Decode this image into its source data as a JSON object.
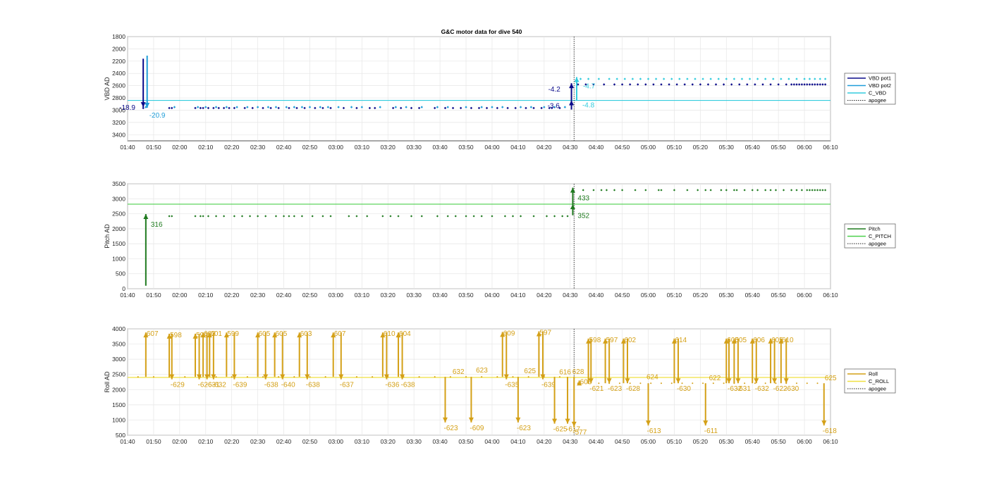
{
  "figure_title": "G&C motor data for dive 540",
  "x_ticks": [
    "01:40",
    "01:50",
    "02:00",
    "02:10",
    "02:20",
    "02:30",
    "02:40",
    "02:50",
    "03:00",
    "03:10",
    "03:20",
    "03:30",
    "03:40",
    "03:50",
    "04:00",
    "04:10",
    "04:20",
    "04:30",
    "04:40",
    "04:50",
    "05:00",
    "05:10",
    "05:20",
    "05:30",
    "05:40",
    "05:50",
    "06:00",
    "06:10"
  ],
  "chart_data": [
    {
      "type": "scatter",
      "title": "G&C motor data for dive 540",
      "ylabel": "VBD AD",
      "xlim_minutes": [
        100,
        370
      ],
      "ylim": [
        1800,
        3500
      ],
      "y_reversed": true,
      "y_ticks": [
        1800,
        2000,
        2200,
        2400,
        2600,
        2800,
        3000,
        3200,
        3400
      ],
      "grid": true,
      "legend": [
        {
          "label": "VBD pot1",
          "color": "#0b0b8a",
          "style": "solid"
        },
        {
          "label": "VBD pot2",
          "color": "#1f9ed9",
          "style": "solid"
        },
        {
          "label": "C_VBD",
          "color": "#33ccdd",
          "style": "solid"
        },
        {
          "label": "apogee",
          "color": "#222222",
          "style": "dotted"
        }
      ],
      "legend_placement": "outside-right",
      "apogee_minutes": 271.5,
      "reference_line": {
        "name": "C_VBD",
        "value": 2840,
        "color": "#33ccdd"
      },
      "points_series1_before_apogee": {
        "y": 2965,
        "x_minutes": [
          106,
          116,
          117,
          126,
          128,
          129,
          131,
          133,
          135,
          137,
          139,
          141,
          145,
          148,
          152,
          155,
          158,
          162,
          165,
          168,
          172,
          175,
          178,
          183,
          188,
          193,
          195,
          202,
          205,
          209,
          212,
          218,
          222,
          225,
          228,
          232,
          235,
          238,
          242,
          246,
          249,
          253,
          256,
          259,
          262,
          263,
          266
        ]
      },
      "points_series2_before_apogee": {
        "y": 2950,
        "x_minutes": [
          107,
          118,
          127,
          130,
          134,
          138,
          142,
          146,
          150,
          154,
          157,
          161,
          164,
          167,
          170,
          174,
          177,
          181,
          186,
          190,
          197,
          203,
          207,
          213,
          219,
          223,
          230,
          236,
          240,
          244,
          251,
          255,
          260,
          264,
          268
        ]
      },
      "points_series1_after_apogee": {
        "y": 2580,
        "x_minutes": [
          273,
          276,
          279,
          283,
          287,
          290,
          293,
          296,
          299,
          302,
          305,
          308,
          311,
          314,
          317,
          320,
          323,
          326,
          329,
          332,
          335,
          338,
          341,
          344,
          347,
          350,
          353,
          355,
          356,
          357,
          358,
          359,
          360,
          361,
          362,
          363,
          364,
          365,
          366,
          367,
          368
        ]
      },
      "points_series2_after_apogee": {
        "y": 2490,
        "x_minutes": [
          274,
          277,
          281,
          285,
          288,
          291,
          294,
          297,
          300,
          303,
          306,
          309,
          312,
          315,
          318,
          321,
          324,
          327,
          330,
          333,
          336,
          339,
          342,
          345,
          348,
          351,
          354,
          357,
          360,
          362,
          364,
          366,
          368
        ]
      },
      "markers": [
        {
          "x_minutes": 106,
          "from": 2160,
          "to": 2950,
          "color": "#0b0b8a",
          "label": "-18.9",
          "label_color": "#0b0b8a"
        },
        {
          "x_minutes": 107.5,
          "from": 2110,
          "to": 2960,
          "color": "#1f9ed9",
          "label": "-20.9",
          "label_color": "#1f9ed9"
        },
        {
          "x_minutes": 270.5,
          "from": 2990,
          "to": 2840,
          "color": "#0b0b8a",
          "label": "-3.6",
          "label_color": "#0b0b8a"
        },
        {
          "x_minutes": 270.5,
          "from": 2840,
          "to": 2560,
          "color": "#0b0b8a",
          "label": "-4.2",
          "label_color": "#0b0b8a"
        },
        {
          "x_minutes": 272.5,
          "from": 2840,
          "to": 2460,
          "color": "#33ccdd",
          "label": "-4.7",
          "label_color": "#33ccdd"
        },
        {
          "x_minutes": 272.5,
          "from": 2840,
          "to": 2840,
          "color": "#33ccdd",
          "label": "-4.8",
          "label_color": "#33ccdd"
        }
      ]
    },
    {
      "type": "scatter",
      "ylabel": "Pitch AD",
      "xlim_minutes": [
        100,
        370
      ],
      "ylim": [
        0,
        3500
      ],
      "y_reversed": false,
      "y_ticks": [
        0,
        500,
        1000,
        1500,
        2000,
        2500,
        3000,
        3500
      ],
      "grid": true,
      "legend": [
        {
          "label": "Pitch",
          "color": "#1f7a1f",
          "style": "solid"
        },
        {
          "label": "C_PITCH",
          "color": "#4cd04c",
          "style": "solid"
        },
        {
          "label": "apogee",
          "color": "#222222",
          "style": "dotted"
        }
      ],
      "legend_placement": "outside-right",
      "apogee_minutes": 271.5,
      "reference_line": {
        "name": "C_PITCH",
        "value": 2820,
        "color": "#4cd04c"
      },
      "points_before_apogee": {
        "y": 2420,
        "x_minutes": [
          116,
          117,
          126,
          128,
          129,
          131,
          134,
          137,
          141,
          144,
          147,
          150,
          153,
          157,
          160,
          162,
          164,
          167,
          171,
          175,
          178,
          185,
          188,
          192,
          198,
          201,
          204,
          209,
          213,
          219,
          223,
          226,
          230,
          233,
          236,
          240,
          245,
          248,
          251,
          256,
          261,
          264,
          267,
          269
        ]
      },
      "points_after_apogee": {
        "y": 3290,
        "x_minutes": [
          275,
          279,
          282,
          284,
          287,
          290,
          295,
          299,
          304,
          305,
          310,
          315,
          319,
          322,
          324,
          328,
          330,
          333,
          334,
          337,
          340,
          342,
          345,
          347,
          349,
          352,
          355,
          357,
          359,
          361,
          362,
          363,
          364,
          365,
          366,
          367,
          368
        ]
      },
      "markers": [
        {
          "x_minutes": 107,
          "from": 100,
          "to": 2490,
          "color": "#1f7a1f",
          "label": "316",
          "label_color": "#1f7a1f"
        },
        {
          "x_minutes": 271,
          "from": 2450,
          "to": 2820,
          "color": "#1f7a1f",
          "label": "352",
          "label_color": "#1f7a1f"
        },
        {
          "x_minutes": 271,
          "from": 2820,
          "to": 3370,
          "color": "#1f7a1f",
          "label": "433",
          "label_color": "#1f7a1f"
        }
      ]
    },
    {
      "type": "scatter",
      "ylabel": "Roll AD",
      "xlim_minutes": [
        100,
        370
      ],
      "ylim": [
        500,
        4000
      ],
      "y_reversed": false,
      "y_ticks": [
        500,
        1000,
        1500,
        2000,
        2500,
        3000,
        3500,
        4000
      ],
      "grid": true,
      "legend": [
        {
          "label": "Roll",
          "color": "#d4a017",
          "style": "solid"
        },
        {
          "label": "C_ROLL",
          "color": "#f0e040",
          "style": "solid"
        },
        {
          "label": "apogee",
          "color": "#222222",
          "style": "dotted"
        }
      ],
      "legend_placement": "outside-right",
      "apogee_minutes": 271.5,
      "reference_line": {
        "name": "C_ROLL",
        "value": 2400,
        "color": "#f0e040"
      },
      "dots_before_apogee_y": 2420,
      "dots_after_apogee_y": 2210,
      "markers": [
        {
          "x_minutes": 107,
          "from": 2420,
          "to": 3880,
          "label": "607"
        },
        {
          "x_minutes": 116,
          "from": 2420,
          "to": 3840,
          "label": "598"
        },
        {
          "x_minutes": 117,
          "from": 3840,
          "to": 2340,
          "label": "-629"
        },
        {
          "x_minutes": 126,
          "from": 2420,
          "to": 3840,
          "label": "599"
        },
        {
          "x_minutes": 127.5,
          "from": 3840,
          "to": 2340,
          "label": "-626"
        },
        {
          "x_minutes": 129,
          "from": 2420,
          "to": 3880,
          "label": "603"
        },
        {
          "x_minutes": 130.5,
          "from": 3880,
          "to": 2340,
          "label": "-631"
        },
        {
          "x_minutes": 131.5,
          "from": 2420,
          "to": 3880,
          "label": "601"
        },
        {
          "x_minutes": 133,
          "from": 3880,
          "to": 2340,
          "label": "-632"
        },
        {
          "x_minutes": 138,
          "from": 2420,
          "to": 3880,
          "label": "599"
        },
        {
          "x_minutes": 141,
          "from": 3880,
          "to": 2340,
          "label": "-639"
        },
        {
          "x_minutes": 150,
          "from": 2420,
          "to": 3880,
          "label": "605"
        },
        {
          "x_minutes": 153,
          "from": 3880,
          "to": 2340,
          "label": "-638"
        },
        {
          "x_minutes": 156.5,
          "from": 2420,
          "to": 3880,
          "label": "605"
        },
        {
          "x_minutes": 159.5,
          "from": 3880,
          "to": 2340,
          "label": "-640"
        },
        {
          "x_minutes": 166,
          "from": 2420,
          "to": 3880,
          "label": "603"
        },
        {
          "x_minutes": 169,
          "from": 3880,
          "to": 2340,
          "label": "-638"
        },
        {
          "x_minutes": 179,
          "from": 2420,
          "to": 3880,
          "label": "607"
        },
        {
          "x_minutes": 182,
          "from": 3880,
          "to": 2340,
          "label": "-637"
        },
        {
          "x_minutes": 198,
          "from": 2420,
          "to": 3880,
          "label": "610"
        },
        {
          "x_minutes": 199.5,
          "from": 3880,
          "to": 2340,
          "label": "-636"
        },
        {
          "x_minutes": 204,
          "from": 2420,
          "to": 3880,
          "label": "604"
        },
        {
          "x_minutes": 205.5,
          "from": 3880,
          "to": 2340,
          "label": "-638"
        },
        {
          "x_minutes": 222,
          "from": 2420,
          "to": 920,
          "label": "-623"
        },
        {
          "x_minutes": 224,
          "from": 2420,
          "to": 2420,
          "label": "632"
        },
        {
          "x_minutes": 232,
          "from": 2420,
          "to": 920,
          "label": "-609"
        },
        {
          "x_minutes": 233,
          "from": 2420,
          "to": 2470,
          "label": "623"
        },
        {
          "x_minutes": 244,
          "from": 2420,
          "to": 3900,
          "label": "609"
        },
        {
          "x_minutes": 245.5,
          "from": 3900,
          "to": 2340,
          "label": "-635"
        },
        {
          "x_minutes": 250,
          "from": 2420,
          "to": 920,
          "label": "-623"
        },
        {
          "x_minutes": 251.5,
          "from": 2420,
          "to": 2450,
          "label": "625"
        },
        {
          "x_minutes": 258,
          "from": 2420,
          "to": 3920,
          "label": "597"
        },
        {
          "x_minutes": 259.5,
          "from": 3920,
          "to": 2340,
          "label": "-639"
        },
        {
          "x_minutes": 264,
          "from": 2420,
          "to": 880,
          "label": "-625"
        },
        {
          "x_minutes": 265,
          "from": 2420,
          "to": 2410,
          "label": "616"
        },
        {
          "x_minutes": 269,
          "from": 2420,
          "to": 880,
          "label": "-617"
        },
        {
          "x_minutes": 270,
          "from": 2420,
          "to": 2420,
          "label": "628"
        },
        {
          "x_minutes": 271.5,
          "from": 2420,
          "to": 780,
          "label": "-577"
        },
        {
          "x_minutes": 273.5,
          "from": 2210,
          "to": 2300,
          "label": "606"
        },
        {
          "x_minutes": 277,
          "from": 2210,
          "to": 3680,
          "label": "598"
        },
        {
          "x_minutes": 278,
          "from": 3680,
          "to": 2210,
          "label": "-621"
        },
        {
          "x_minutes": 283.5,
          "from": 2210,
          "to": 3680,
          "label": "597"
        },
        {
          "x_minutes": 285,
          "from": 3680,
          "to": 2210,
          "label": "-623"
        },
        {
          "x_minutes": 290.5,
          "from": 2210,
          "to": 3680,
          "label": "602"
        },
        {
          "x_minutes": 292,
          "from": 3680,
          "to": 2210,
          "label": "-628"
        },
        {
          "x_minutes": 300,
          "from": 2210,
          "to": 820,
          "label": "-613"
        },
        {
          "x_minutes": 298.5,
          "from": 2210,
          "to": 2250,
          "label": "624"
        },
        {
          "x_minutes": 310,
          "from": 2210,
          "to": 3680,
          "label": "614"
        },
        {
          "x_minutes": 311.5,
          "from": 3680,
          "to": 2210,
          "label": "-630"
        },
        {
          "x_minutes": 322,
          "from": 2210,
          "to": 820,
          "label": "-611"
        },
        {
          "x_minutes": 322.5,
          "from": 2210,
          "to": 2210,
          "label": "622"
        },
        {
          "x_minutes": 330,
          "from": 2210,
          "to": 3680,
          "label": "605"
        },
        {
          "x_minutes": 331,
          "from": 3680,
          "to": 2210,
          "label": "-632"
        },
        {
          "x_minutes": 333,
          "from": 2210,
          "to": 3680,
          "label": "605"
        },
        {
          "x_minutes": 334.5,
          "from": 3680,
          "to": 2210,
          "label": "-631"
        },
        {
          "x_minutes": 340,
          "from": 2210,
          "to": 3680,
          "label": "606"
        },
        {
          "x_minutes": 341.5,
          "from": 3680,
          "to": 2210,
          "label": "-632"
        },
        {
          "x_minutes": 347,
          "from": 2210,
          "to": 3680,
          "label": "605"
        },
        {
          "x_minutes": 348.5,
          "from": 3680,
          "to": 2210,
          "label": "-622"
        },
        {
          "x_minutes": 351,
          "from": 2210,
          "to": 3680,
          "label": "610"
        },
        {
          "x_minutes": 353,
          "from": 3680,
          "to": 2210,
          "label": "-630"
        },
        {
          "x_minutes": 367,
          "from": 2210,
          "to": 2210,
          "label": "625"
        },
        {
          "x_minutes": 367.5,
          "from": 2210,
          "to": 820,
          "label": "-618"
        }
      ]
    }
  ]
}
